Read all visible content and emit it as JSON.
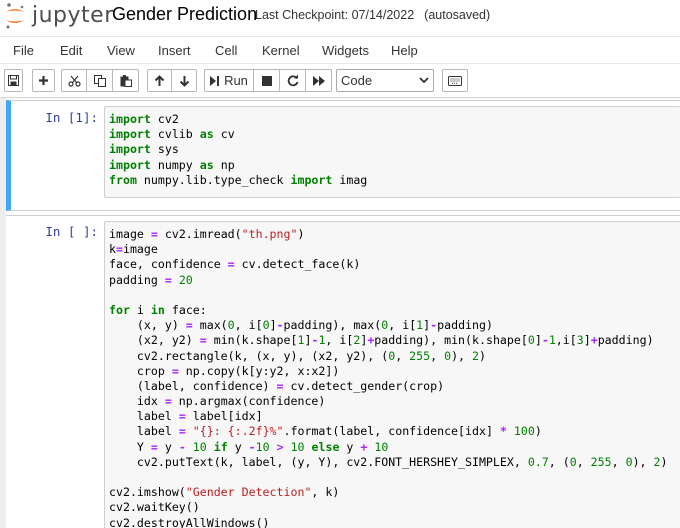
{
  "header": {
    "logo_text": "jupyter",
    "notebook_title": "Gender Prediction",
    "checkpoint_label": "Last Checkpoint: 07/14/2022",
    "autosave_status": "(autosaved)"
  },
  "menubar": {
    "items": [
      "File",
      "Edit",
      "View",
      "Insert",
      "Cell",
      "Kernel",
      "Widgets",
      "Help"
    ]
  },
  "toolbar": {
    "buttons": [
      "save-icon",
      "plus-icon",
      "scissors-icon",
      "copy-icon",
      "paste-icon",
      "arrow-up-icon",
      "arrow-down-icon",
      "run-button",
      "stop-icon",
      "restart-icon",
      "fast-forward-icon",
      "keyboard-icon"
    ],
    "run_label": "Run",
    "cell_type": "Code"
  },
  "cells": [
    {
      "prompt": "In [1]:",
      "selected": true,
      "accent_color": "#42a5f5",
      "lines": [
        [
          [
            "kw",
            "import"
          ],
          [
            "t",
            " cv2"
          ]
        ],
        [
          [
            "kw",
            "import"
          ],
          [
            "t",
            " cvlib "
          ],
          [
            "kw",
            "as"
          ],
          [
            "t",
            " cv"
          ]
        ],
        [
          [
            "kw",
            "import"
          ],
          [
            "t",
            " sys"
          ]
        ],
        [
          [
            "kw",
            "import"
          ],
          [
            "t",
            " numpy "
          ],
          [
            "kw",
            "as"
          ],
          [
            "t",
            " np"
          ]
        ],
        [
          [
            "kw",
            "from"
          ],
          [
            "t",
            " numpy.lib.type_check "
          ],
          [
            "kw",
            "import"
          ],
          [
            "t",
            " imag"
          ]
        ]
      ]
    },
    {
      "prompt": "In [ ]:",
      "selected": false,
      "lines": [
        [
          [
            "t",
            "image "
          ],
          [
            "op",
            "="
          ],
          [
            "t",
            " cv2.imread("
          ],
          [
            "st",
            "\"th.png\""
          ],
          [
            "t",
            ")"
          ]
        ],
        [
          [
            "t",
            "k"
          ],
          [
            "op",
            "="
          ],
          [
            "t",
            "image"
          ]
        ],
        [
          [
            "t",
            "face, confidence "
          ],
          [
            "op",
            "="
          ],
          [
            "t",
            " cv.detect_face(k)"
          ]
        ],
        [
          [
            "t",
            "padding "
          ],
          [
            "op",
            "="
          ],
          [
            "t",
            " "
          ],
          [
            "nu",
            "20"
          ]
        ],
        [],
        [
          [
            "kw",
            "for"
          ],
          [
            "t",
            " i "
          ],
          [
            "kw",
            "in"
          ],
          [
            "t",
            " face:"
          ]
        ],
        [
          [
            "t",
            "    (x, y) "
          ],
          [
            "op",
            "="
          ],
          [
            "t",
            " max("
          ],
          [
            "nu",
            "0"
          ],
          [
            "t",
            ", i["
          ],
          [
            "nu",
            "0"
          ],
          [
            "t",
            "]"
          ],
          [
            "op",
            "-"
          ],
          [
            "t",
            "padding), max("
          ],
          [
            "nu",
            "0"
          ],
          [
            "t",
            ", i["
          ],
          [
            "nu",
            "1"
          ],
          [
            "t",
            "]"
          ],
          [
            "op",
            "-"
          ],
          [
            "t",
            "padding)"
          ]
        ],
        [
          [
            "t",
            "    (x2, y2) "
          ],
          [
            "op",
            "="
          ],
          [
            "t",
            " min(k.shape["
          ],
          [
            "nu",
            "1"
          ],
          [
            "t",
            "]"
          ],
          [
            "op",
            "-"
          ],
          [
            "nu",
            "1"
          ],
          [
            "t",
            ", i["
          ],
          [
            "nu",
            "2"
          ],
          [
            "t",
            "]"
          ],
          [
            "op",
            "+"
          ],
          [
            "t",
            "padding), min(k.shape["
          ],
          [
            "nu",
            "0"
          ],
          [
            "t",
            "]"
          ],
          [
            "op",
            "-"
          ],
          [
            "nu",
            "1"
          ],
          [
            "t",
            ",i["
          ],
          [
            "nu",
            "3"
          ],
          [
            "t",
            "]"
          ],
          [
            "op",
            "+"
          ],
          [
            "t",
            "padding)"
          ]
        ],
        [
          [
            "t",
            "    cv2.rectangle(k, (x, y), (x2, y2), ("
          ],
          [
            "nu",
            "0"
          ],
          [
            "t",
            ", "
          ],
          [
            "nu",
            "255"
          ],
          [
            "t",
            ", "
          ],
          [
            "nu",
            "0"
          ],
          [
            "t",
            "), "
          ],
          [
            "nu",
            "2"
          ],
          [
            "t",
            ")"
          ]
        ],
        [
          [
            "t",
            "    crop "
          ],
          [
            "op",
            "="
          ],
          [
            "t",
            " np.copy(k[y:y2, x:x2])"
          ]
        ],
        [
          [
            "t",
            "    (label, confidence) "
          ],
          [
            "op",
            "="
          ],
          [
            "t",
            " cv.detect_gender(crop)"
          ]
        ],
        [
          [
            "t",
            "    idx "
          ],
          [
            "op",
            "="
          ],
          [
            "t",
            " np.argmax(confidence)"
          ]
        ],
        [
          [
            "t",
            "    label "
          ],
          [
            "op",
            "="
          ],
          [
            "t",
            " label[idx]"
          ]
        ],
        [
          [
            "t",
            "    label "
          ],
          [
            "op",
            "="
          ],
          [
            "t",
            " "
          ],
          [
            "st",
            "\"{}: {:.2f}%\""
          ],
          [
            "t",
            ".format(label, confidence[idx] "
          ],
          [
            "op",
            "*"
          ],
          [
            "t",
            " "
          ],
          [
            "nu",
            "100"
          ],
          [
            "t",
            ")"
          ]
        ],
        [
          [
            "t",
            "    Y "
          ],
          [
            "op",
            "="
          ],
          [
            "t",
            " y "
          ],
          [
            "op",
            "-"
          ],
          [
            "t",
            " "
          ],
          [
            "nu",
            "10"
          ],
          [
            "t",
            " "
          ],
          [
            "kw",
            "if"
          ],
          [
            "t",
            " y "
          ],
          [
            "op",
            "-"
          ],
          [
            "nu",
            "10"
          ],
          [
            "t",
            " "
          ],
          [
            "op",
            ">"
          ],
          [
            "t",
            " "
          ],
          [
            "nu",
            "10"
          ],
          [
            "t",
            " "
          ],
          [
            "kw",
            "else"
          ],
          [
            "t",
            " y "
          ],
          [
            "op",
            "+"
          ],
          [
            "t",
            " "
          ],
          [
            "nu",
            "10"
          ]
        ],
        [
          [
            "t",
            "    cv2.putText(k, label, (y, Y), cv2.FONT_HERSHEY_SIMPLEX, "
          ],
          [
            "nu",
            "0.7"
          ],
          [
            "t",
            ", ("
          ],
          [
            "nu",
            "0"
          ],
          [
            "t",
            ", "
          ],
          [
            "nu",
            "255"
          ],
          [
            "t",
            ", "
          ],
          [
            "nu",
            "0"
          ],
          [
            "t",
            "), "
          ],
          [
            "nu",
            "2"
          ],
          [
            "t",
            ")"
          ]
        ],
        [],
        [
          [
            "t",
            "cv2.imshow("
          ],
          [
            "st",
            "\"Gender Detection\""
          ],
          [
            "t",
            ", k)"
          ]
        ],
        [
          [
            "t",
            "cv2.waitKey()"
          ]
        ],
        [
          [
            "t",
            "cv2.destroyAllWindows()"
          ]
        ]
      ]
    }
  ]
}
